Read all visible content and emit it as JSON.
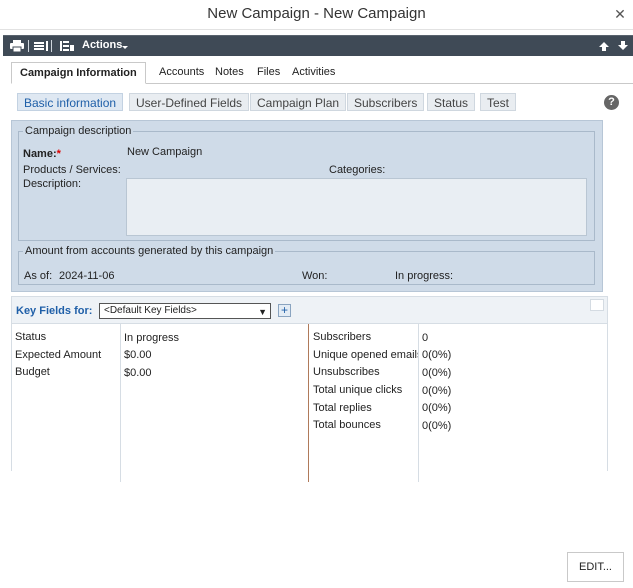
{
  "window": {
    "title": "New Campaign - New Campaign"
  },
  "toolbar": {
    "actions_label": "Actions"
  },
  "tabs": [
    {
      "label": "Campaign Information"
    },
    {
      "label": "Accounts"
    },
    {
      "label": "Notes"
    },
    {
      "label": "Files"
    },
    {
      "label": "Activities"
    }
  ],
  "subtabs": [
    {
      "label": "Basic information"
    },
    {
      "label": "User-Defined Fields"
    },
    {
      "label": "Campaign Plan"
    },
    {
      "label": "Subscribers"
    },
    {
      "label": "Status"
    },
    {
      "label": "Test"
    }
  ],
  "help_label": "?",
  "campaign_description": {
    "legend": "Campaign description",
    "name_label": "Name:",
    "required_mark": "*",
    "name_value": "New Campaign",
    "products_label": "Products / Services:",
    "categories_label": "Categories:",
    "description_label": "Description:"
  },
  "amount_group": {
    "legend": "Amount from accounts generated by this campaign",
    "as_of_label": "As of:",
    "as_of_value": "2024-11-06",
    "won_label": "Won:",
    "in_progress_label": "In progress:"
  },
  "key_fields": {
    "label": "Key Fields for:",
    "selected": "<Default Key Fields>",
    "add_label": "+",
    "left": {
      "labels": [
        "Status",
        "Expected Amount",
        "Budget"
      ],
      "values": [
        "In progress",
        "$0.00",
        "$0.00"
      ]
    },
    "right": {
      "labels": [
        "Subscribers",
        "Unique opened emails",
        "Unsubscribes",
        "Total unique clicks",
        "Total replies",
        "Total bounces"
      ],
      "values": [
        "0",
        "0(0%)",
        "0(0%)",
        "0(0%)",
        "0(0%)",
        "0(0%)"
      ]
    }
  },
  "edit_button": {
    "label": "EDIT..."
  },
  "colors": {
    "toolbar_bg": "#3f4a56",
    "panel_bg": "#cfdbe8",
    "accent_blue": "#1f5fa8",
    "divider_brown": "#b07a5a"
  },
  "icons": [
    "close-icon",
    "print-icon",
    "list-icon",
    "columns-icon",
    "arrow-up-icon",
    "arrow-down-icon",
    "help-icon",
    "expand-icon"
  ]
}
